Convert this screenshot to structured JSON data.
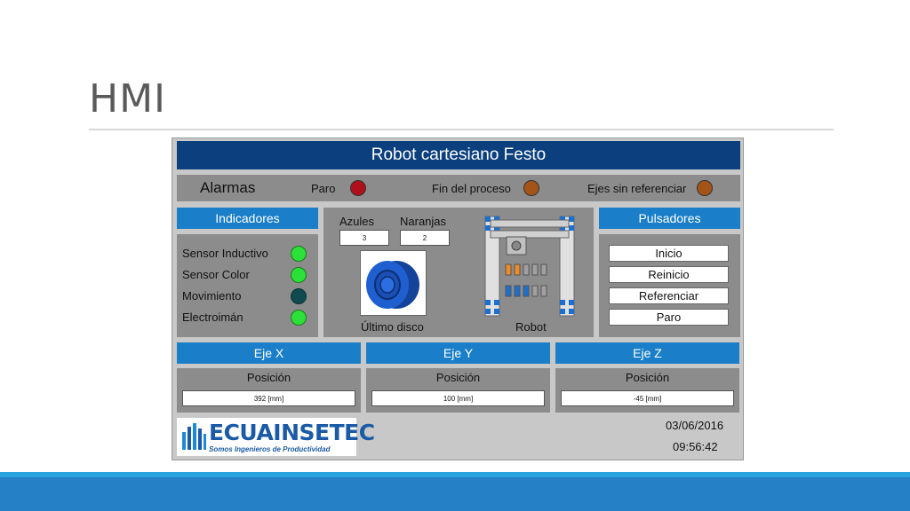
{
  "slide": {
    "title": "HMI"
  },
  "hmi": {
    "title": "Robot cartesiano Festo",
    "alarms": {
      "title": "Alarmas",
      "items": [
        {
          "label": "Paro",
          "color": "#b0101a"
        },
        {
          "label": "Fin del proceso",
          "color": "#a55417"
        },
        {
          "label": "Ejes sin referenciar",
          "color": "#a55417"
        }
      ]
    },
    "indicators": {
      "title": "Indicadores",
      "items": [
        {
          "label": "Sensor Inductivo",
          "state": "on"
        },
        {
          "label": "Sensor Color",
          "state": "on"
        },
        {
          "label": "Movimiento",
          "state": "off"
        },
        {
          "label": "Electroimán",
          "state": "on"
        }
      ]
    },
    "counters": {
      "blue_label": "Azules",
      "blue_value": "3",
      "orange_label": "Naranjas",
      "orange_value": "2",
      "last_disc_label": "Último disco",
      "robot_label": "Robot"
    },
    "buttons": {
      "title": "Pulsadores",
      "items": [
        "Inicio",
        "Reinicio",
        "Referenciar",
        "Paro"
      ]
    },
    "axes": [
      {
        "title": "Eje X",
        "pos_label": "Posición",
        "value": "392 [mm]"
      },
      {
        "title": "Eje Y",
        "pos_label": "Posición",
        "value": "100 [mm]"
      },
      {
        "title": "Eje Z",
        "pos_label": "Posición",
        "value": "-45 [mm]"
      }
    ],
    "logo": {
      "name": "ECUAINSETEC",
      "tagline": "Somos Ingenieros de Productividad"
    },
    "date": "03/06/2016",
    "time": "09:56:42",
    "colors": {
      "header": "#0b3f7e",
      "section": "#1a7fc8",
      "lamp_on": "#2ce03a",
      "lamp_off": "#0f4a4f",
      "footer": "#2680c6"
    }
  }
}
